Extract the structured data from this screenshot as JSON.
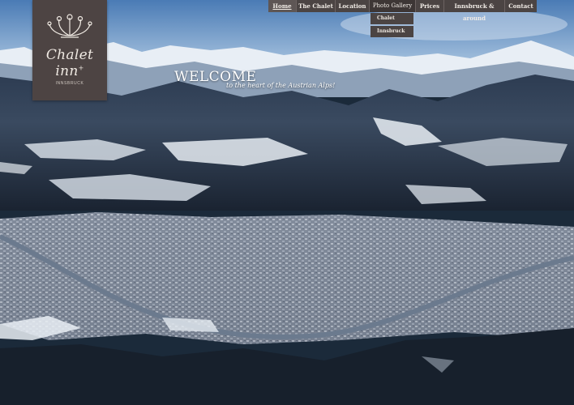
{
  "logo": {
    "brand": "Chalet inn",
    "mark": "+",
    "city": "INNSBRUCK",
    "emblem_icon": "ornamental-flower-icon"
  },
  "nav": {
    "home": "Home",
    "chalet": "The Chalet",
    "location": "Location",
    "gallery": "Photo Gallery",
    "prices": "Prices",
    "innsbruck": "Innsbruck & around",
    "contact": "Contact"
  },
  "dropdown": {
    "items": [
      "Chalet",
      "Innsbruck"
    ]
  },
  "hero": {
    "heading": "WELCOME",
    "tagline": "to the heart of the Austrian Alps!"
  },
  "colors": {
    "nav_bg": "#4b4443",
    "logo_bg": "#4d4443",
    "text": "#f1ece6"
  }
}
